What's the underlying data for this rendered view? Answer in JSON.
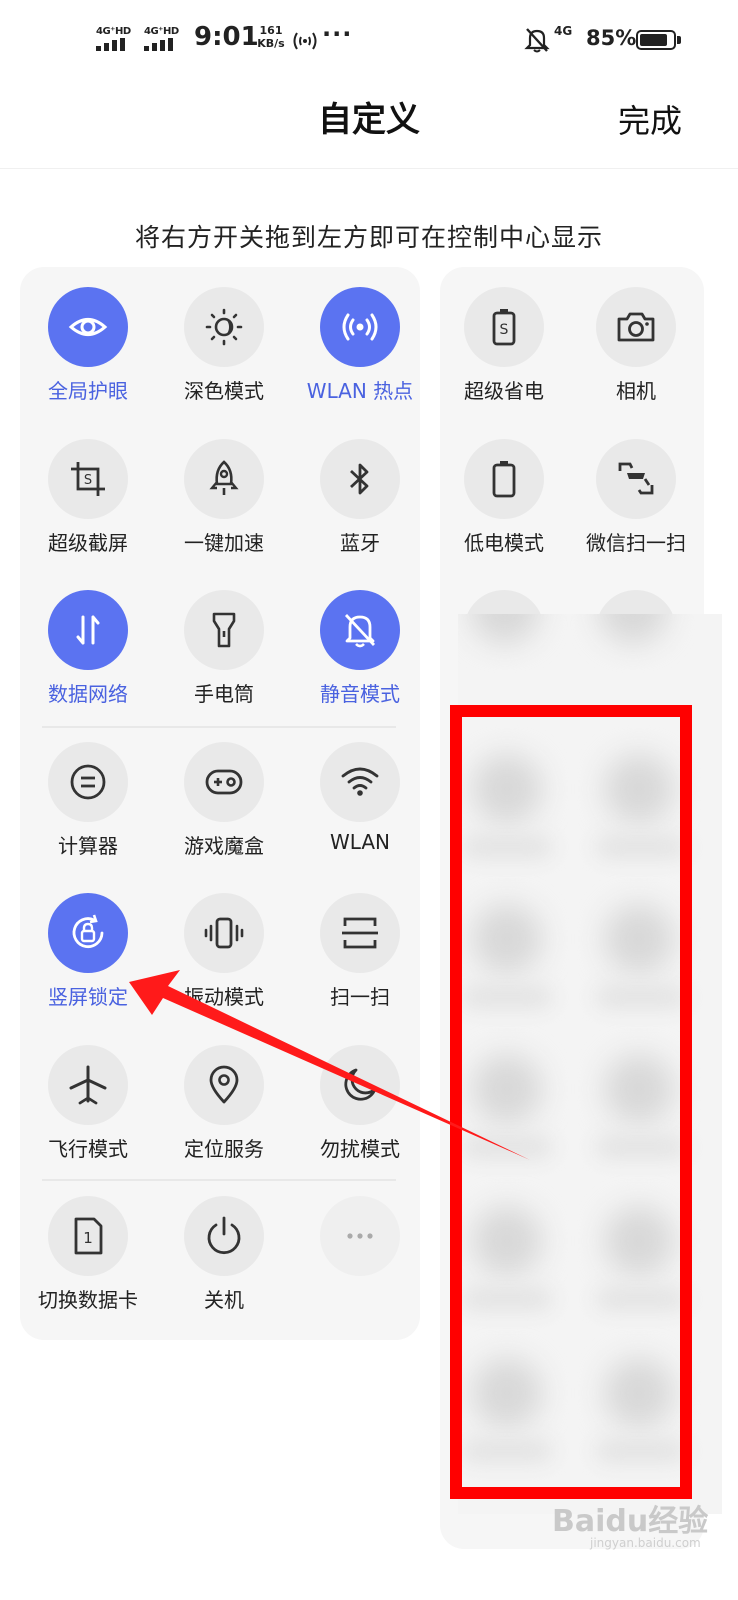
{
  "status_bar": {
    "sim1": "4G⁺HD",
    "sim2": "4G⁺HD",
    "time": "9:01",
    "speed_value": "161",
    "speed_unit": "KB/s",
    "more": "···",
    "network_4g": "4G",
    "battery": "85%",
    "battery_level": 0.85
  },
  "header": {
    "title": "自定义",
    "done_label": "完成"
  },
  "hint": "将右方开关拖到左方即可在控制中心显示",
  "colors": {
    "accent": "#5b73f1",
    "active_label": "#4a62e0",
    "tile_bg": "#e9e9e9",
    "panel_bg": "#f6f6f6",
    "highlight": "#ff0000"
  },
  "left_tiles": [
    {
      "label": "全局护眼",
      "icon": "eye-icon",
      "active": true
    },
    {
      "label": "深色模式",
      "icon": "dark-mode-icon",
      "active": false
    },
    {
      "label": "WLAN 热点",
      "icon": "hotspot-icon",
      "active": true
    },
    {
      "label": "超级截屏",
      "icon": "screenshot-icon",
      "active": false
    },
    {
      "label": "一键加速",
      "icon": "rocket-icon",
      "active": false
    },
    {
      "label": "蓝牙",
      "icon": "bluetooth-icon",
      "active": false
    },
    {
      "label": "数据网络",
      "icon": "data-network-icon",
      "active": true
    },
    {
      "label": "手电筒",
      "icon": "flashlight-icon",
      "active": false
    },
    {
      "label": "静音模式",
      "icon": "mute-bell-icon",
      "active": true
    },
    {
      "label": "计算器",
      "icon": "calculator-icon",
      "active": false
    },
    {
      "label": "游戏魔盒",
      "icon": "gamepad-icon",
      "active": false
    },
    {
      "label": "WLAN",
      "icon": "wifi-icon",
      "active": false
    },
    {
      "label": "竖屏锁定",
      "icon": "rotation-lock-icon",
      "active": true
    },
    {
      "label": "振动模式",
      "icon": "vibrate-icon",
      "active": false
    },
    {
      "label": "扫一扫",
      "icon": "scan-icon",
      "active": false
    },
    {
      "label": "飞行模式",
      "icon": "airplane-icon",
      "active": false
    },
    {
      "label": "定位服务",
      "icon": "location-icon",
      "active": false
    },
    {
      "label": "勿扰模式",
      "icon": "moon-icon",
      "active": false
    },
    {
      "label": "切换数据卡",
      "icon": "sim-card-icon",
      "active": false
    },
    {
      "label": "关机",
      "icon": "power-icon",
      "active": false
    },
    {
      "label": "",
      "icon": "more-icon",
      "active": false
    }
  ],
  "right_tiles": [
    {
      "label": "超级省电",
      "icon": "super-power-save-icon"
    },
    {
      "label": "相机",
      "icon": "camera-icon"
    },
    {
      "label": "低电模式",
      "icon": "low-battery-icon"
    },
    {
      "label": "微信扫一扫",
      "icon": "wechat-scan-icon"
    }
  ],
  "watermark": {
    "text": "Baidu经验",
    "sub": "jingyan.baidu.com"
  }
}
